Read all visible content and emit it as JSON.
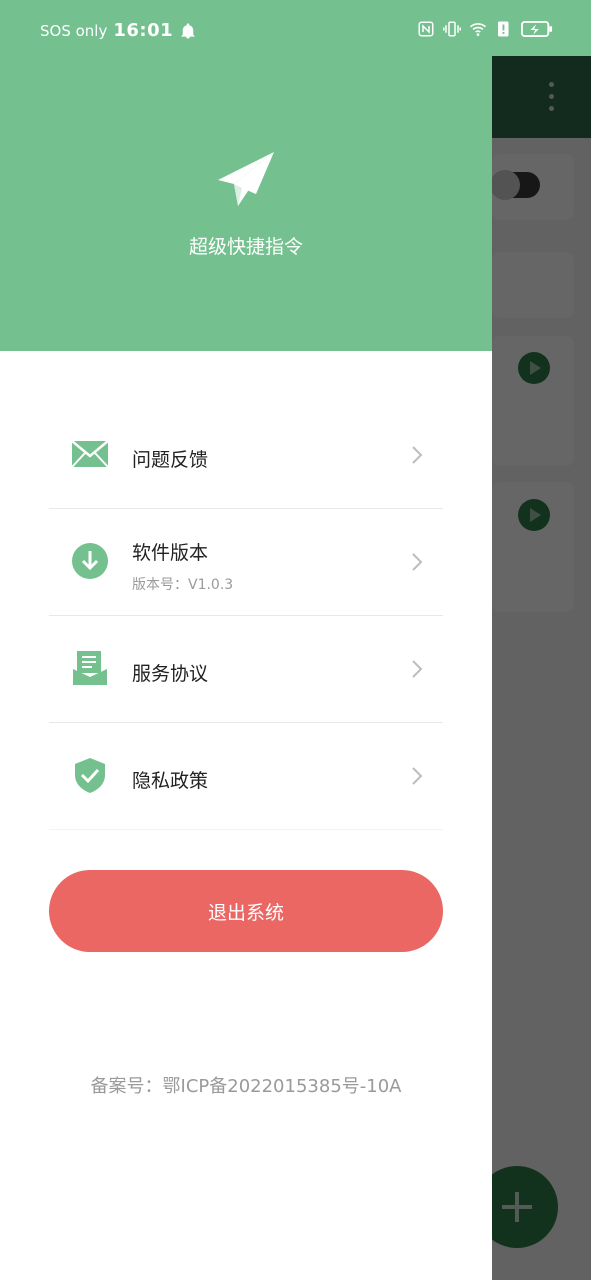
{
  "status_bar": {
    "carrier": "SOS only",
    "time": "16:01",
    "icons": [
      "bell-icon",
      "nfc-icon",
      "vibrate-icon",
      "wifi-icon",
      "alert-icon",
      "battery-charging-icon"
    ]
  },
  "drawer": {
    "header": {
      "icon": "paper-plane-icon",
      "title": "超级快捷指令"
    },
    "menu": [
      {
        "label": "问题反馈",
        "icon": "mail-icon"
      },
      {
        "label": "软件版本",
        "sub": "版本号：V1.0.3",
        "icon": "download-icon"
      },
      {
        "label": "服务协议",
        "icon": "document-icon"
      },
      {
        "label": "隐私政策",
        "icon": "shield-check-icon"
      }
    ],
    "logout_label": "退出系统",
    "icp": "备案号：鄂ICP备2022015385号-10A"
  },
  "colors": {
    "primary_green": "#74c08f",
    "logout_red": "#ea6763",
    "dark_green": "#2f6b4c"
  }
}
